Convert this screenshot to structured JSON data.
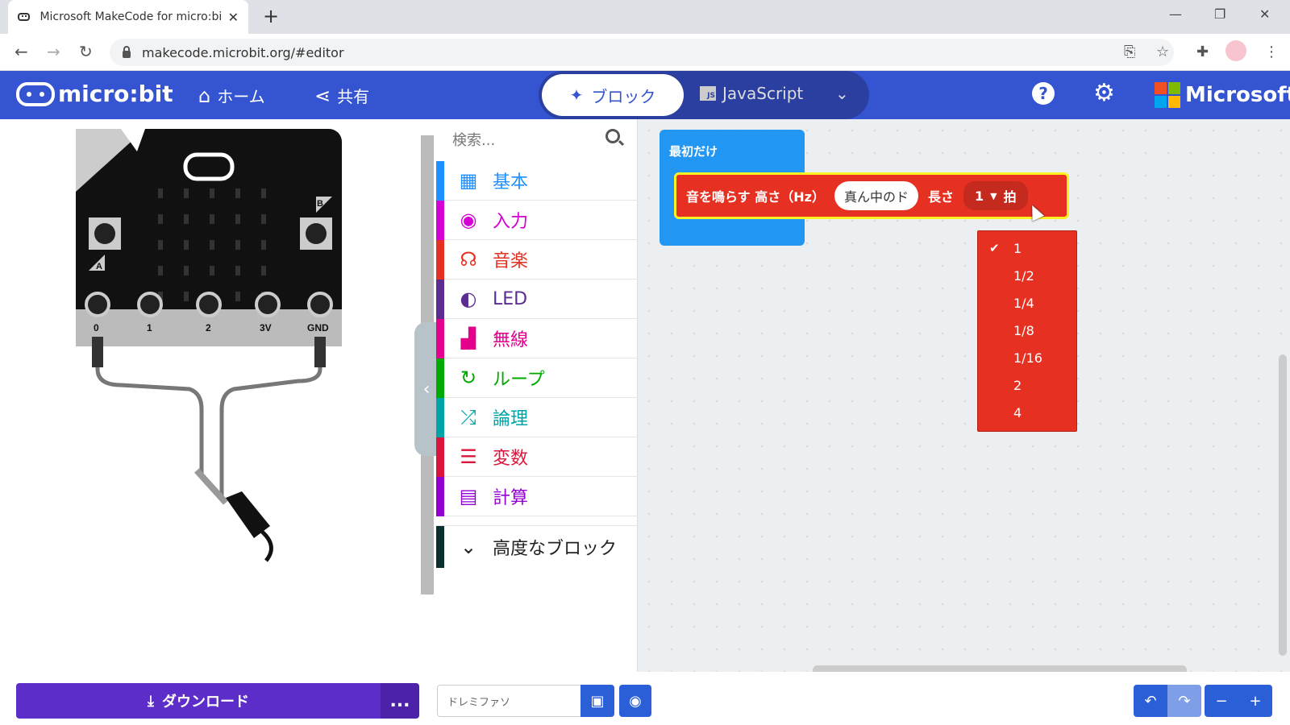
{
  "browser": {
    "tab_title": "Microsoft MakeCode for micro:bit",
    "tab_close": "✕",
    "new_tab": "+",
    "url": "makecode.microbit.org/#editor"
  },
  "header": {
    "logo_text": "micro:bit",
    "home": "ホーム",
    "share": "共有",
    "mode_blocks": "ブロック",
    "mode_js": "JavaScript",
    "js_badge": "JS",
    "brand": "Microsoft"
  },
  "simulator": {
    "button_a": "A",
    "button_b": "B",
    "pins": [
      "0",
      "1",
      "2",
      "3V",
      "GND"
    ]
  },
  "toolbox": {
    "search_placeholder": "検索...",
    "categories": [
      {
        "label": "基本",
        "color": "#1e90ff"
      },
      {
        "label": "入力",
        "color": "#d400d4"
      },
      {
        "label": "音楽",
        "color": "#e63022"
      },
      {
        "label": "LED",
        "color": "#5c2d91"
      },
      {
        "label": "無線",
        "color": "#e3008c"
      },
      {
        "label": "ループ",
        "color": "#00aa00"
      },
      {
        "label": "論理",
        "color": "#00a4a6"
      },
      {
        "label": "変数",
        "color": "#dc143c"
      },
      {
        "label": "計算",
        "color": "#9400d3"
      }
    ],
    "advanced": "高度なブロック"
  },
  "workspace": {
    "on_start": "最初だけ",
    "tone_block": {
      "prefix": "音を鳴らす 高さ（Hz）",
      "note": "真ん中のド",
      "length_label": "長さ",
      "beat_value": "1",
      "beat_unit": "拍"
    },
    "beat_options": [
      "1",
      "1/2",
      "1/4",
      "1/8",
      "1/16",
      "2",
      "4"
    ],
    "selected_option": "1"
  },
  "footer": {
    "download": "ダウンロード",
    "more": "...",
    "project_name": "ドレミファソ"
  }
}
